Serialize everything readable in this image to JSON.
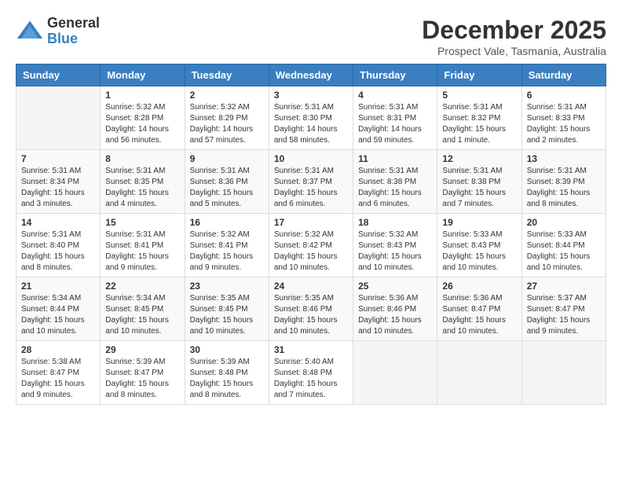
{
  "logo": {
    "general": "General",
    "blue": "Blue"
  },
  "title": "December 2025",
  "subtitle": "Prospect Vale, Tasmania, Australia",
  "days_header": [
    "Sunday",
    "Monday",
    "Tuesday",
    "Wednesday",
    "Thursday",
    "Friday",
    "Saturday"
  ],
  "weeks": [
    [
      {
        "day": "",
        "info": ""
      },
      {
        "day": "1",
        "info": "Sunrise: 5:32 AM\nSunset: 8:28 PM\nDaylight: 14 hours\nand 56 minutes."
      },
      {
        "day": "2",
        "info": "Sunrise: 5:32 AM\nSunset: 8:29 PM\nDaylight: 14 hours\nand 57 minutes."
      },
      {
        "day": "3",
        "info": "Sunrise: 5:31 AM\nSunset: 8:30 PM\nDaylight: 14 hours\nand 58 minutes."
      },
      {
        "day": "4",
        "info": "Sunrise: 5:31 AM\nSunset: 8:31 PM\nDaylight: 14 hours\nand 59 minutes."
      },
      {
        "day": "5",
        "info": "Sunrise: 5:31 AM\nSunset: 8:32 PM\nDaylight: 15 hours\nand 1 minute."
      },
      {
        "day": "6",
        "info": "Sunrise: 5:31 AM\nSunset: 8:33 PM\nDaylight: 15 hours\nand 2 minutes."
      }
    ],
    [
      {
        "day": "7",
        "info": "Sunrise: 5:31 AM\nSunset: 8:34 PM\nDaylight: 15 hours\nand 3 minutes."
      },
      {
        "day": "8",
        "info": "Sunrise: 5:31 AM\nSunset: 8:35 PM\nDaylight: 15 hours\nand 4 minutes."
      },
      {
        "day": "9",
        "info": "Sunrise: 5:31 AM\nSunset: 8:36 PM\nDaylight: 15 hours\nand 5 minutes."
      },
      {
        "day": "10",
        "info": "Sunrise: 5:31 AM\nSunset: 8:37 PM\nDaylight: 15 hours\nand 6 minutes."
      },
      {
        "day": "11",
        "info": "Sunrise: 5:31 AM\nSunset: 8:38 PM\nDaylight: 15 hours\nand 6 minutes."
      },
      {
        "day": "12",
        "info": "Sunrise: 5:31 AM\nSunset: 8:38 PM\nDaylight: 15 hours\nand 7 minutes."
      },
      {
        "day": "13",
        "info": "Sunrise: 5:31 AM\nSunset: 8:39 PM\nDaylight: 15 hours\nand 8 minutes."
      }
    ],
    [
      {
        "day": "14",
        "info": "Sunrise: 5:31 AM\nSunset: 8:40 PM\nDaylight: 15 hours\nand 8 minutes."
      },
      {
        "day": "15",
        "info": "Sunrise: 5:31 AM\nSunset: 8:41 PM\nDaylight: 15 hours\nand 9 minutes."
      },
      {
        "day": "16",
        "info": "Sunrise: 5:32 AM\nSunset: 8:41 PM\nDaylight: 15 hours\nand 9 minutes."
      },
      {
        "day": "17",
        "info": "Sunrise: 5:32 AM\nSunset: 8:42 PM\nDaylight: 15 hours\nand 10 minutes."
      },
      {
        "day": "18",
        "info": "Sunrise: 5:32 AM\nSunset: 8:43 PM\nDaylight: 15 hours\nand 10 minutes."
      },
      {
        "day": "19",
        "info": "Sunrise: 5:33 AM\nSunset: 8:43 PM\nDaylight: 15 hours\nand 10 minutes."
      },
      {
        "day": "20",
        "info": "Sunrise: 5:33 AM\nSunset: 8:44 PM\nDaylight: 15 hours\nand 10 minutes."
      }
    ],
    [
      {
        "day": "21",
        "info": "Sunrise: 5:34 AM\nSunset: 8:44 PM\nDaylight: 15 hours\nand 10 minutes."
      },
      {
        "day": "22",
        "info": "Sunrise: 5:34 AM\nSunset: 8:45 PM\nDaylight: 15 hours\nand 10 minutes."
      },
      {
        "day": "23",
        "info": "Sunrise: 5:35 AM\nSunset: 8:45 PM\nDaylight: 15 hours\nand 10 minutes."
      },
      {
        "day": "24",
        "info": "Sunrise: 5:35 AM\nSunset: 8:46 PM\nDaylight: 15 hours\nand 10 minutes."
      },
      {
        "day": "25",
        "info": "Sunrise: 5:36 AM\nSunset: 8:46 PM\nDaylight: 15 hours\nand 10 minutes."
      },
      {
        "day": "26",
        "info": "Sunrise: 5:36 AM\nSunset: 8:47 PM\nDaylight: 15 hours\nand 10 minutes."
      },
      {
        "day": "27",
        "info": "Sunrise: 5:37 AM\nSunset: 8:47 PM\nDaylight: 15 hours\nand 9 minutes."
      }
    ],
    [
      {
        "day": "28",
        "info": "Sunrise: 5:38 AM\nSunset: 8:47 PM\nDaylight: 15 hours\nand 9 minutes."
      },
      {
        "day": "29",
        "info": "Sunrise: 5:39 AM\nSunset: 8:47 PM\nDaylight: 15 hours\nand 8 minutes."
      },
      {
        "day": "30",
        "info": "Sunrise: 5:39 AM\nSunset: 8:48 PM\nDaylight: 15 hours\nand 8 minutes."
      },
      {
        "day": "31",
        "info": "Sunrise: 5:40 AM\nSunset: 8:48 PM\nDaylight: 15 hours\nand 7 minutes."
      },
      {
        "day": "",
        "info": ""
      },
      {
        "day": "",
        "info": ""
      },
      {
        "day": "",
        "info": ""
      }
    ]
  ]
}
